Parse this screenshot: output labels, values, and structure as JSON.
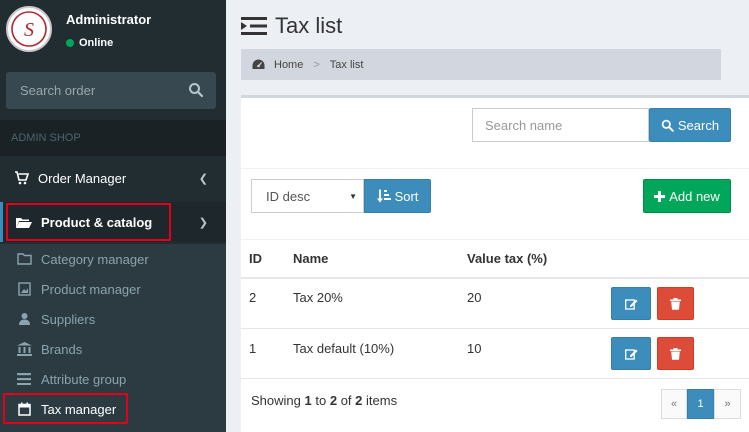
{
  "user": {
    "name": "Administrator",
    "status": "Online"
  },
  "sidebar_search": {
    "placeholder": "Search order"
  },
  "sidebar": {
    "header": "ADMIN SHOP",
    "order_manager": "Order Manager",
    "product_catalog": "Product & catalog",
    "sub_items": [
      {
        "label": "Category manager"
      },
      {
        "label": "Product manager"
      },
      {
        "label": "Suppliers"
      },
      {
        "label": "Brands"
      },
      {
        "label": "Attribute group"
      },
      {
        "label": "Tax manager"
      }
    ]
  },
  "page": {
    "title": "Tax list"
  },
  "breadcrumb": {
    "home": "Home",
    "sep": ">",
    "current": "Tax list"
  },
  "search": {
    "placeholder": "Search name",
    "button": "Search"
  },
  "sort": {
    "selected": "ID desc",
    "button": "Sort"
  },
  "add_button": "Add new",
  "table": {
    "headers": {
      "id": "ID",
      "name": "Name",
      "value": "Value tax (%)"
    },
    "rows": [
      {
        "id": "2",
        "name": "Tax 20%",
        "value": "20"
      },
      {
        "id": "1",
        "name": "Tax default (10%)",
        "value": "10"
      }
    ]
  },
  "footer": {
    "prefix": "Showing",
    "from": "1",
    "to_word": "to",
    "to": "2",
    "of_word": "of",
    "total": "2",
    "suffix": "items"
  },
  "pagination": {
    "prev": "«",
    "page": "1",
    "next": "»"
  },
  "colors": {
    "primary": "#3c8dbc",
    "success": "#00a65a",
    "danger": "#dd4b39",
    "sidebar": "#222d32",
    "highlight": "#e3001b"
  }
}
